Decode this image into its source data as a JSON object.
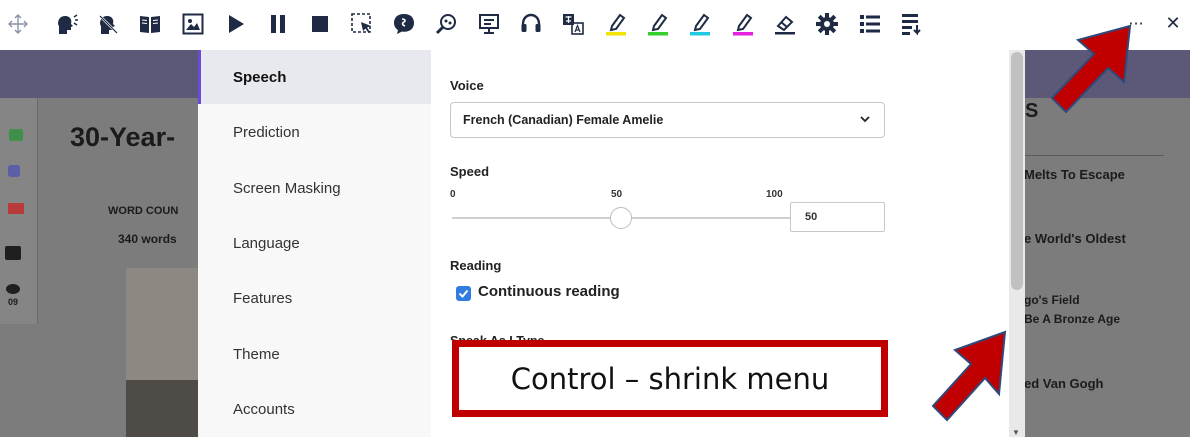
{
  "toolbar": {
    "icons": [
      "move-icon",
      "talking-head-icon",
      "talking-head-muted-icon",
      "book-icon",
      "picture-icon",
      "play-icon",
      "pause-icon",
      "stop-icon",
      "screen-select-icon",
      "speech-bubble-icon",
      "picture-dictionary-icon",
      "presentation-icon",
      "headset-icon",
      "translate-icon",
      "highlighter-yellow-icon",
      "highlighter-green-icon",
      "highlighter-cyan-icon",
      "highlighter-magenta-icon",
      "eraser-icon",
      "settings-gear-icon",
      "bullet-list-icon",
      "vocabulary-list-icon"
    ],
    "more_label": "···",
    "close_label": "✕",
    "highlight_colors": [
      "#f2e300",
      "#34d12e",
      "#23c9e3",
      "#e61ee0"
    ]
  },
  "background": {
    "article_title": "30-Year-",
    "word_count_label": "WORD COUN",
    "word_count_value": "340 words",
    "count_badge": "09",
    "right_heading": "S",
    "related": [
      "Melts To Escape",
      "e World's Oldest",
      "go's Field",
      "Be A Bronze Age",
      "ed Van Gogh"
    ]
  },
  "settings": {
    "nav": [
      "Speech",
      "Prediction",
      "Screen Masking",
      "Language",
      "Features",
      "Theme",
      "Accounts"
    ],
    "active_nav": "Speech",
    "voice": {
      "label": "Voice",
      "selected": "French (Canadian) Female Amelie"
    },
    "speed": {
      "label": "Speed",
      "min_label": "0",
      "mid_label": "50",
      "max_label": "100",
      "value": "50",
      "fraction": 0.5
    },
    "reading": {
      "label": "Reading",
      "continuous_label": "Continuous reading",
      "continuous_checked": true
    },
    "speak_as_i_type_label": "Speak As I Type"
  },
  "annotation": {
    "callout_text": "Control – shrink menu",
    "color": "#c00000"
  },
  "colors": {
    "accent": "#6b4bd6",
    "checkbox": "#2f7de1",
    "band": "#5b5878"
  }
}
